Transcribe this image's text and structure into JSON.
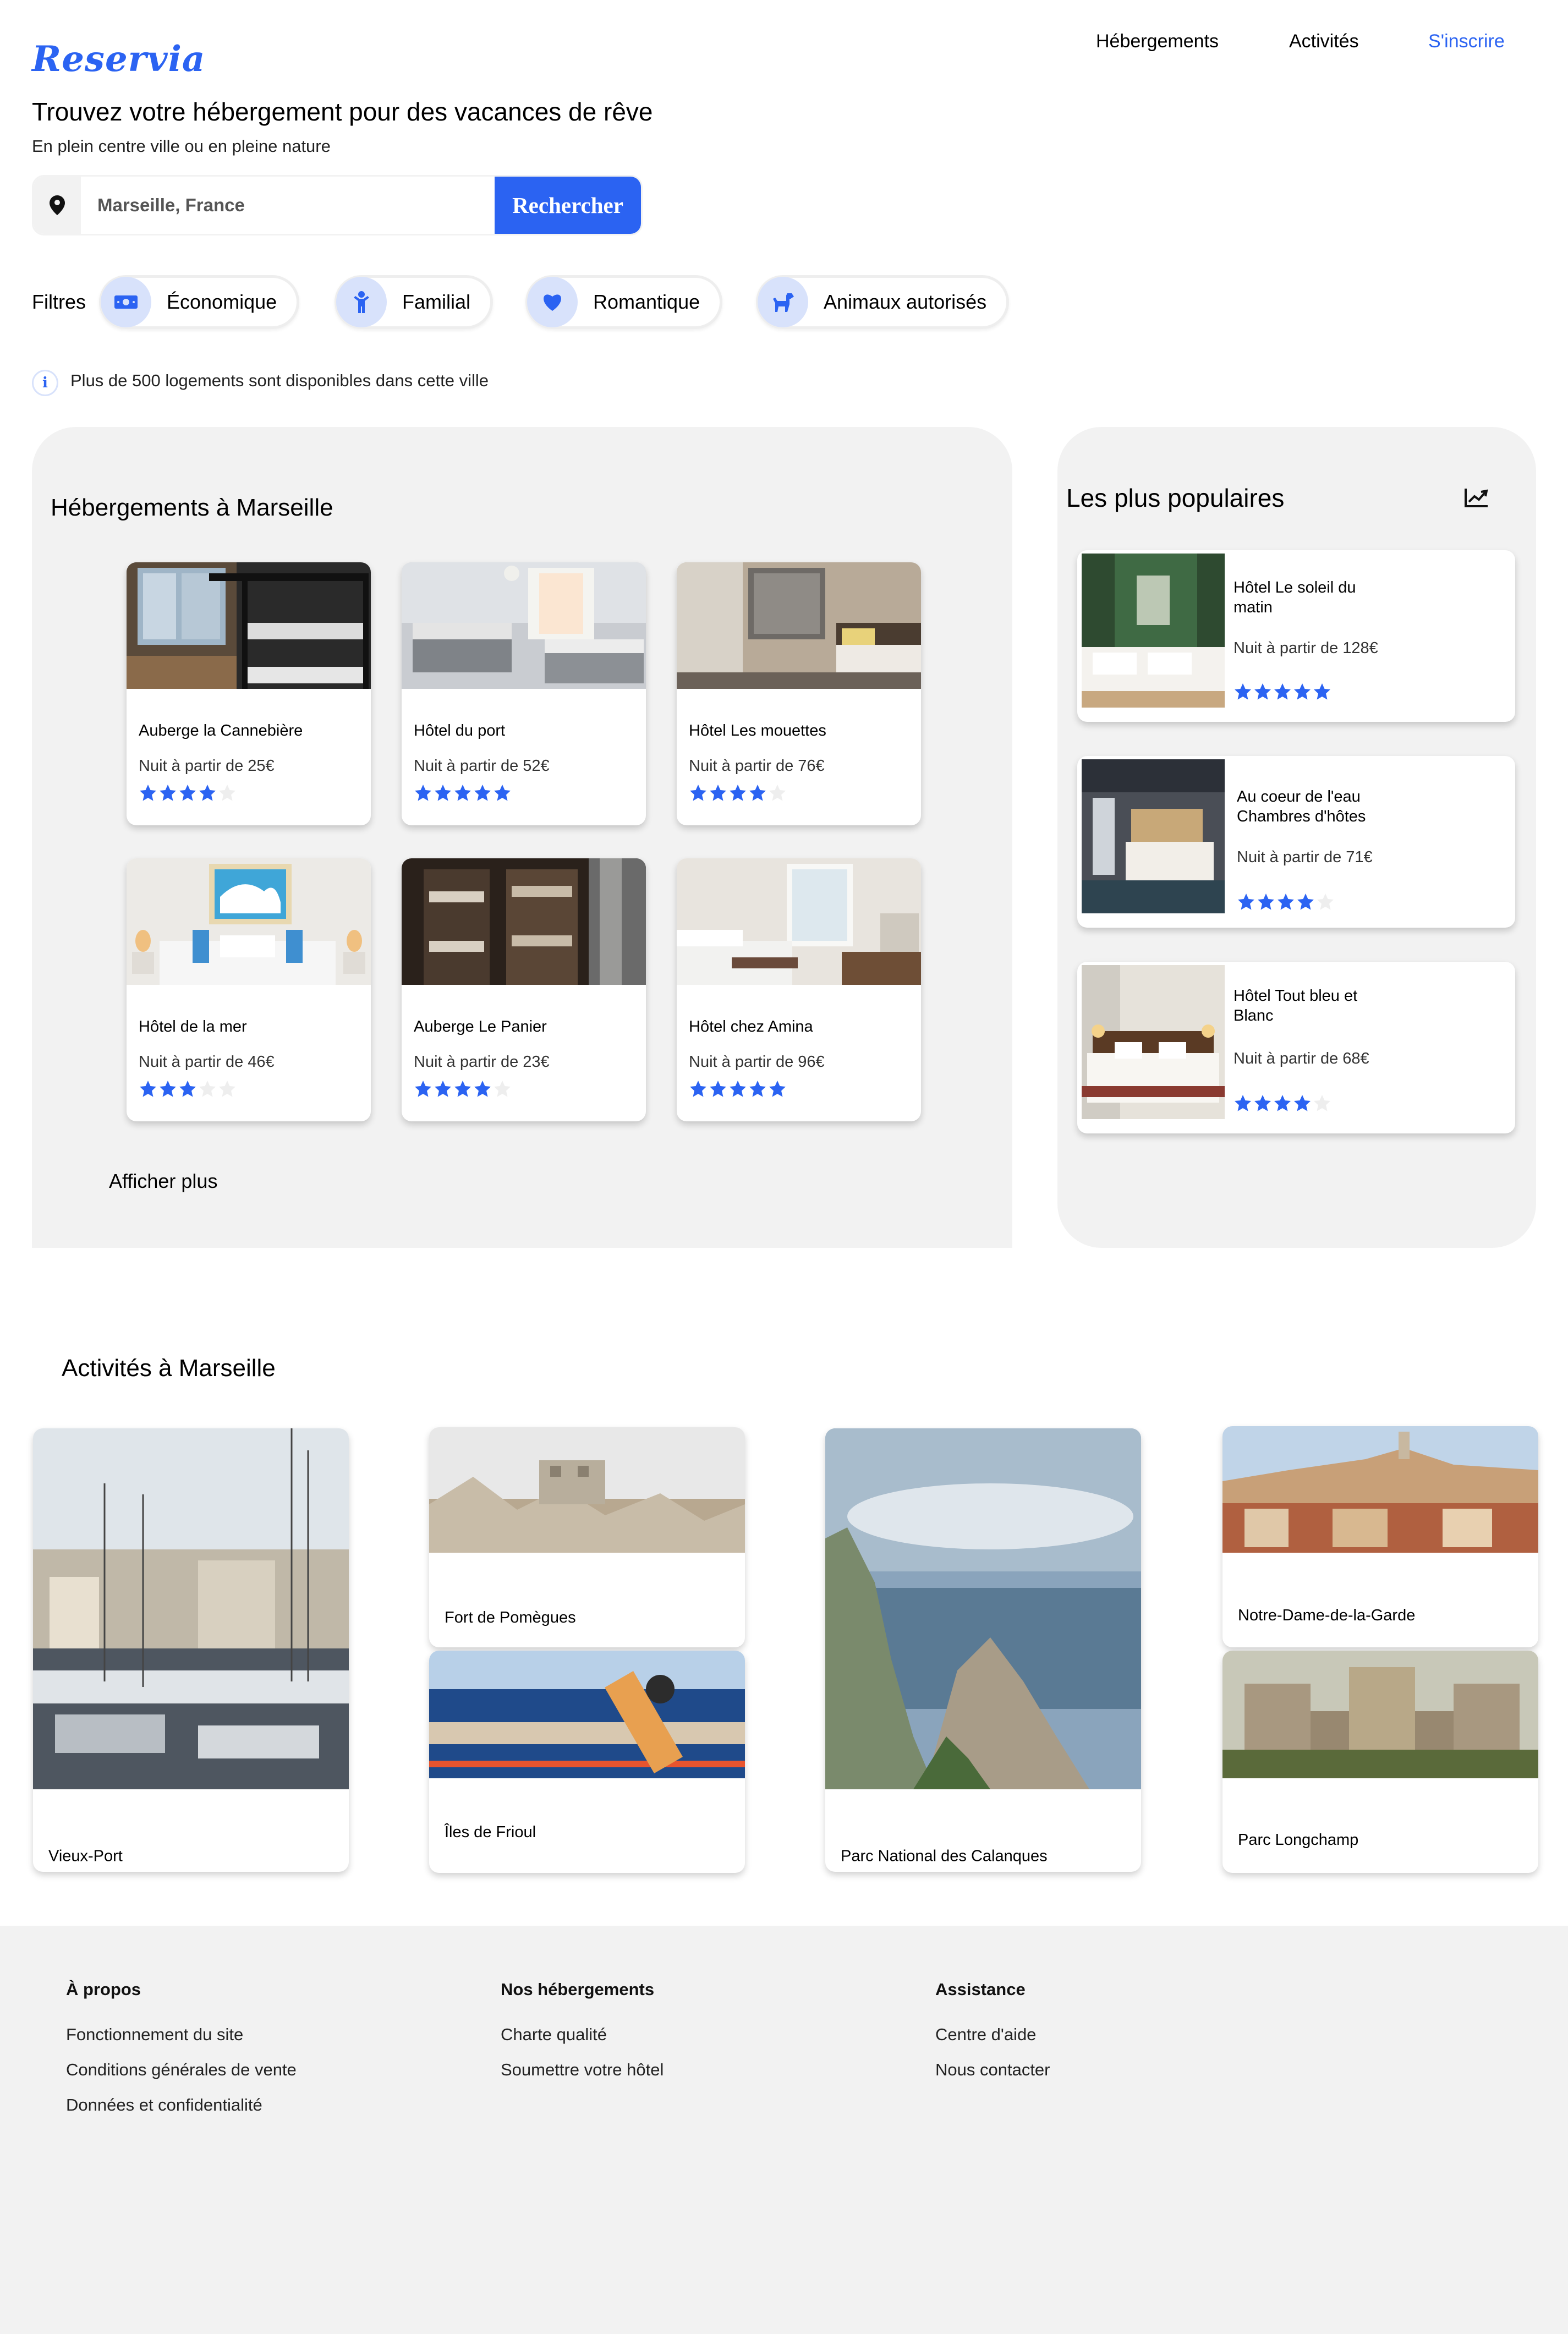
{
  "header": {
    "logo": "Reservia",
    "nav": [
      "Hébergements",
      "Activités",
      "S'inscrire"
    ]
  },
  "hero": {
    "title": "Trouvez votre hébergement pour des vacances de rêve",
    "subtitle": "En plein centre ville ou en pleine nature"
  },
  "search": {
    "value": "Marseille, France",
    "button": "Rechercher"
  },
  "filters": {
    "label": "Filtres",
    "items": [
      {
        "label": "Économique",
        "icon": "money-icon"
      },
      {
        "label": "Familial",
        "icon": "family-icon"
      },
      {
        "label": "Romantique",
        "icon": "heart-icon"
      },
      {
        "label": "Animaux autorisés",
        "icon": "dog-icon"
      }
    ]
  },
  "info": {
    "icon": "info-icon",
    "text": "Plus de 500 logements sont disponibles dans cette ville"
  },
  "hebergements": {
    "title": "Hébergements à Marseille",
    "more": "Afficher plus",
    "items": [
      {
        "name": "Auberge la Cannebière",
        "price": "Nuit à partir de 25€",
        "rating": 4
      },
      {
        "name": "Hôtel du port",
        "price": "Nuit à partir de 52€",
        "rating": 5
      },
      {
        "name": "Hôtel Les mouettes",
        "price": "Nuit à partir de 76€",
        "rating": 4
      },
      {
        "name": "Hôtel de la mer",
        "price": "Nuit à partir de 46€",
        "rating": 3
      },
      {
        "name": "Auberge Le Panier",
        "price": "Nuit à partir de 23€",
        "rating": 4
      },
      {
        "name": "Hôtel chez Amina",
        "price": "Nuit à partir de 96€",
        "rating": 5
      }
    ]
  },
  "popular": {
    "title": "Les plus populaires",
    "icon": "trending-icon",
    "items": [
      {
        "name": "Hôtel Le soleil du matin",
        "price": "Nuit à partir de 128€",
        "rating": 5
      },
      {
        "name": "Au coeur de l'eau Chambres d'hôtes",
        "price": "Nuit à partir de 71€",
        "rating": 4
      },
      {
        "name": "Hôtel Tout bleu et Blanc",
        "price": "Nuit à partir de 68€",
        "rating": 4
      }
    ]
  },
  "activities": {
    "title": "Activités à Marseille",
    "items": [
      "Vieux-Port",
      "Fort de Pomègues",
      "Îles de Frioul",
      "Parc National des Calanques",
      "Notre-Dame-de-la-Garde",
      "Parc Longchamp"
    ]
  },
  "footer": {
    "columns": [
      {
        "heading": "À propos",
        "links": [
          "Fonctionnement du site",
          "Conditions générales de vente",
          "Données et confidentialité"
        ]
      },
      {
        "heading": "Nos hébergements",
        "links": [
          "Charte qualité",
          "Soumettre votre hôtel"
        ]
      },
      {
        "heading": "Assistance",
        "links": [
          "Centre d'aide",
          "Nous contacter"
        ]
      }
    ]
  },
  "colors": {
    "accent": "#2b63f2",
    "panel": "#f2f2f2",
    "icon_bg": "#d8e2fb",
    "star_empty": "#eeeeee"
  }
}
